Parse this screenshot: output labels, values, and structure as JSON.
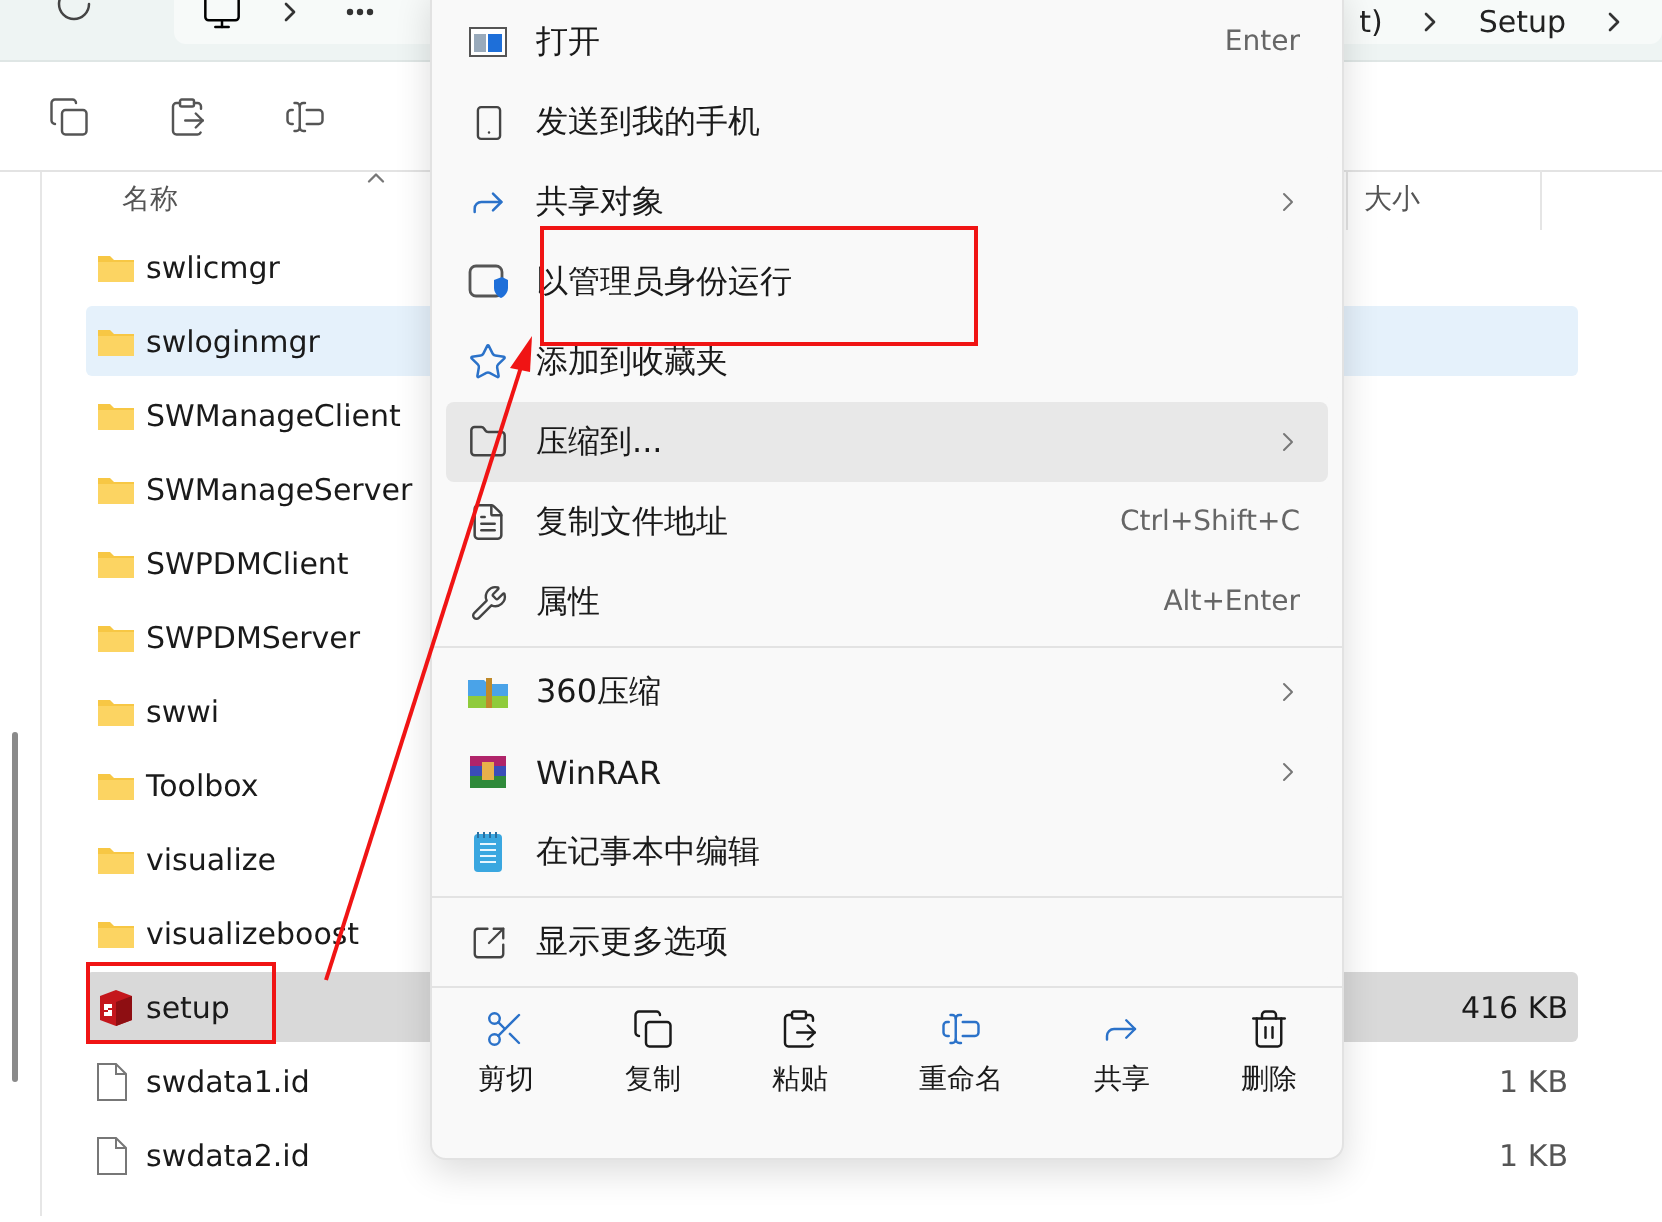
{
  "address_bar": {
    "crumbs": [
      "t)",
      "Setup"
    ]
  },
  "columns": [
    "名称",
    "大小"
  ],
  "files": [
    {
      "name": "swlicmgr",
      "kind": "folder",
      "selected": false,
      "hovered": false
    },
    {
      "name": "swloginmgr",
      "kind": "folder",
      "selected": false,
      "hovered": true
    },
    {
      "name": "SWManageClient",
      "kind": "folder",
      "selected": false,
      "hovered": false
    },
    {
      "name": "SWManageServer",
      "kind": "folder",
      "selected": false,
      "hovered": false
    },
    {
      "name": "SWPDMClient",
      "kind": "folder",
      "selected": false,
      "hovered": false
    },
    {
      "name": "SWPDMServer",
      "kind": "folder",
      "selected": false,
      "hovered": false
    },
    {
      "name": "swwi",
      "kind": "folder",
      "selected": false,
      "hovered": false
    },
    {
      "name": "Toolbox",
      "kind": "folder",
      "selected": false,
      "hovered": false
    },
    {
      "name": "visualize",
      "kind": "folder",
      "selected": false,
      "hovered": false
    },
    {
      "name": "visualizeboost",
      "kind": "folder",
      "selected": false,
      "hovered": false
    },
    {
      "name": "setup",
      "kind": "app",
      "size": "416 KB",
      "selected": true,
      "hovered": false
    },
    {
      "name": "swdata1.id",
      "kind": "file",
      "size": "1 KB",
      "selected": false,
      "hovered": false
    },
    {
      "name": "swdata2.id",
      "kind": "file",
      "size": "1 KB",
      "selected": false,
      "hovered": false
    }
  ],
  "context_menu": {
    "items": [
      {
        "kind": "item",
        "label": "打开",
        "shortcut": "Enter",
        "submenu": false,
        "hovered": false
      },
      {
        "kind": "item",
        "label": "发送到我的手机",
        "submenu": false,
        "hovered": false
      },
      {
        "kind": "item",
        "label": "共享对象",
        "submenu": true,
        "hovered": false
      },
      {
        "kind": "item",
        "label": "以管理员身份运行",
        "submenu": false,
        "hovered": false
      },
      {
        "kind": "item",
        "label": "添加到收藏夹",
        "submenu": false,
        "hovered": false
      },
      {
        "kind": "item",
        "label": "压缩到...",
        "submenu": true,
        "hovered": true
      },
      {
        "kind": "item",
        "label": "复制文件地址",
        "shortcut": "Ctrl+Shift+C",
        "submenu": false,
        "hovered": false
      },
      {
        "kind": "item",
        "label": "属性",
        "shortcut": "Alt+Enter",
        "submenu": false,
        "hovered": false
      },
      {
        "kind": "separator"
      },
      {
        "kind": "item",
        "label": "360压缩",
        "submenu": true,
        "hovered": false
      },
      {
        "kind": "item",
        "label": "WinRAR",
        "submenu": true,
        "hovered": false
      },
      {
        "kind": "item",
        "label": "在记事本中编辑",
        "submenu": false,
        "hovered": false
      },
      {
        "kind": "separator"
      },
      {
        "kind": "item",
        "label": "显示更多选项",
        "submenu": false,
        "hovered": false
      }
    ],
    "actions": [
      "剪切",
      "复制",
      "粘贴",
      "重命名",
      "共享",
      "删除"
    ]
  }
}
